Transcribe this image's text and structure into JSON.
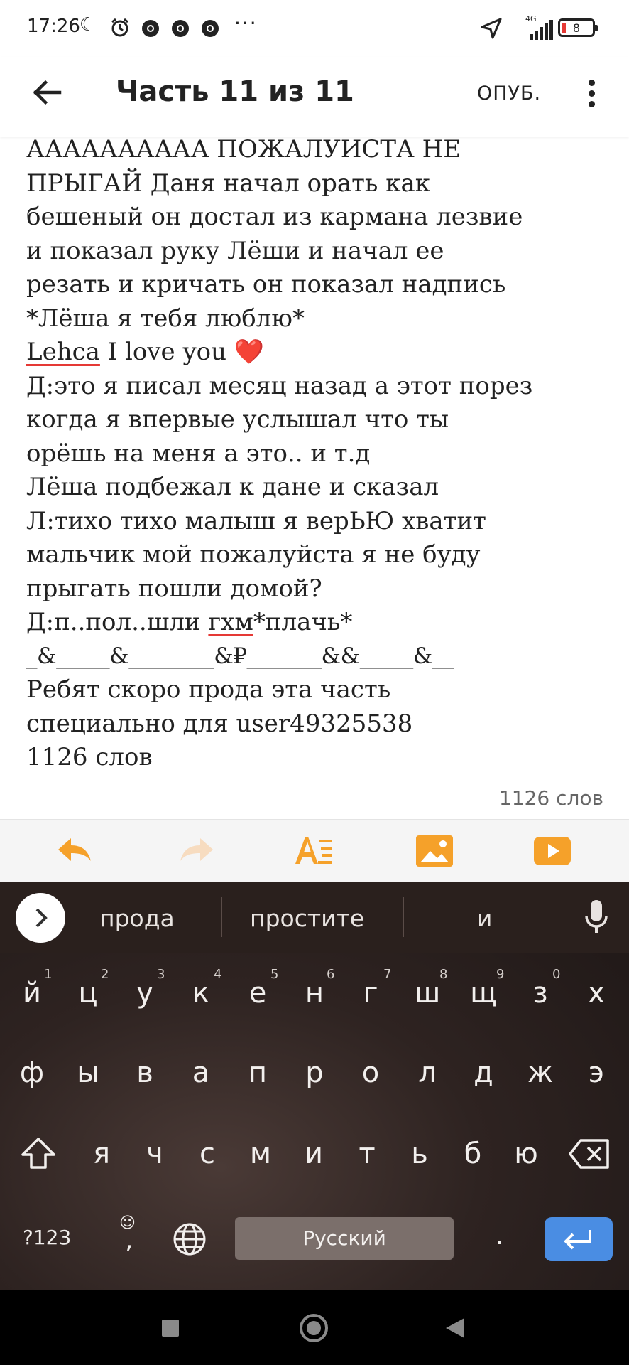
{
  "status_bar": {
    "time": "17:26",
    "network": "4G",
    "battery": "8",
    "more_label": "···"
  },
  "app_bar": {
    "title": "Часть 11 из 11",
    "publish_label": "ОПУБ."
  },
  "content": {
    "lines": [
      "АААААААААА ПОЖАЛУИСТА НЕ",
      "ПРЫГАЙ Даня начал орать как",
      "бешеный он достал из кармана лезвие",
      "и показал руку Лёши и начал ее",
      "резать и кричать он показал надпись",
      "*Лёша я тебя люблю*",
      "Lehca I love you ❤️",
      "Д:это я писал месяц назад а этот порез",
      "когда я впервые услышал что ты",
      "орёшь на меня а это.. и т.д",
      "Лёша подбежал к дане и сказал",
      "Л:тихо тихо малыш я верЬЮ хватит",
      "мальчик мой пожалуйста я не буду",
      "прыгать пошли домой?",
      "Д:п..пол..шли гхм*плачь*",
      "_&_____&________&₽_______&&_____&__",
      "Ребят скоро прода эта часть",
      "специально для  user49325538",
      "1126 слов"
    ],
    "line7_word": "Lehca",
    "line7_rest": " I love you ",
    "line7_emoji": "❤️",
    "line15_pre": "Д:п..пол..шли ",
    "line15_word": "гхм",
    "line15_post": "*плачь*",
    "word_count": "1126 слов"
  },
  "toolbar": {
    "accent_color": "#f5a12a",
    "icons": [
      "undo-icon",
      "redo-icon",
      "text-format-icon",
      "image-icon",
      "video-icon"
    ]
  },
  "keyboard": {
    "suggestions": [
      "прода",
      "простите",
      "и"
    ],
    "row1": [
      "й",
      "ц",
      "у",
      "к",
      "е",
      "н",
      "г",
      "ш",
      "щ",
      "з",
      "х"
    ],
    "row1_hints": [
      "1",
      "2",
      "3",
      "4",
      "5",
      "6",
      "7",
      "8",
      "9",
      "0"
    ],
    "row2": [
      "ф",
      "ы",
      "в",
      "а",
      "п",
      "р",
      "о",
      "л",
      "д",
      "ж",
      "э"
    ],
    "row3": [
      "я",
      "ч",
      "с",
      "м",
      "и",
      "т",
      "ь",
      "б",
      "ю"
    ],
    "symbols_label": "?123",
    "comma": ",",
    "period": ".",
    "space_label": "Русский"
  }
}
